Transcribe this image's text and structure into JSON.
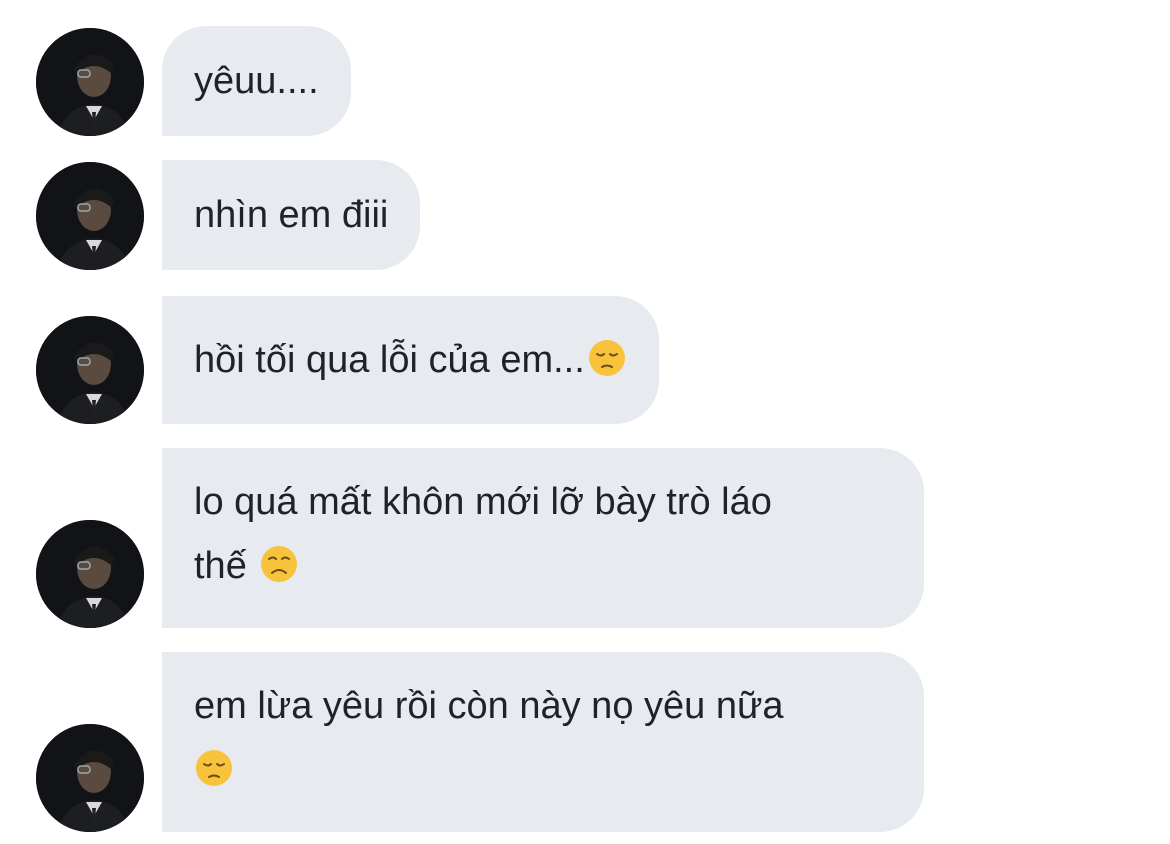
{
  "messages": [
    {
      "text": "yêuu....",
      "emoji": null
    },
    {
      "text": "nhìn em điii",
      "emoji": null
    },
    {
      "text": "hồi tối qua lỗi của em...",
      "emoji": "pensive-face"
    },
    {
      "line1": "lo quá mất khôn mới lỡ bày trò láo",
      "line2": "thế",
      "emoji": "disappointed-face"
    },
    {
      "line1": "em lừa yêu rồi còn này nọ yêu nữa",
      "line2": "",
      "emoji": "pensive-face"
    }
  ],
  "colors": {
    "bubble_bg": "#e7ebf0",
    "text": "#1f2328",
    "emoji_face": "#f7c33b"
  },
  "icons": {
    "avatar": "profile-photo-avatar"
  }
}
